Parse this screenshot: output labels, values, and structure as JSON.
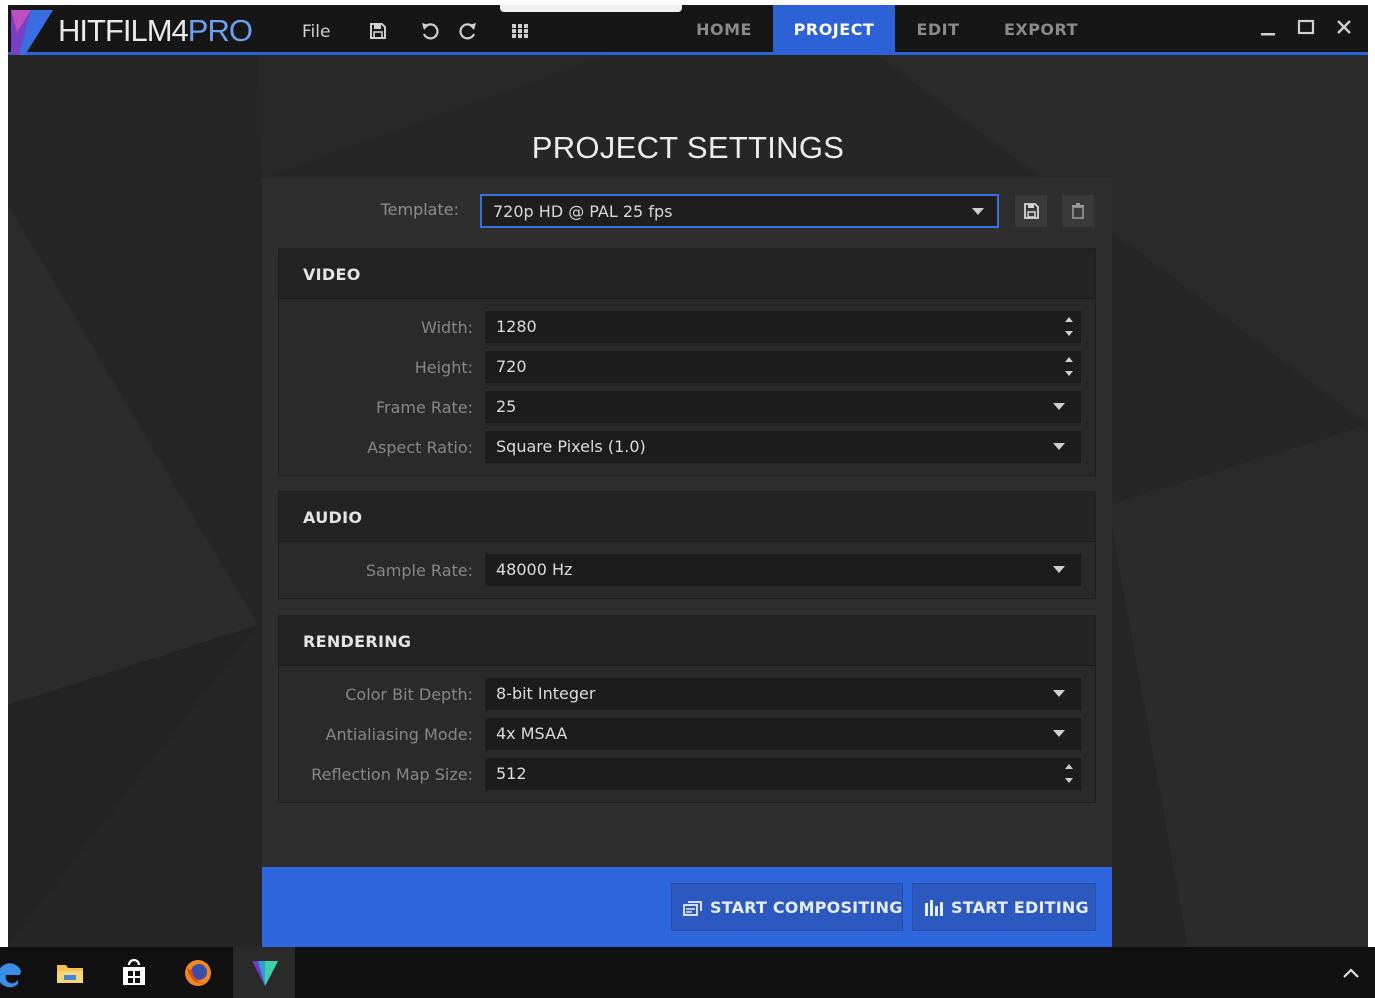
{
  "app": {
    "brand_main": "HITFILM4",
    "brand_pro": "PRO",
    "menu_file": "File",
    "tabs": [
      {
        "label": "HOME",
        "active": false
      },
      {
        "label": "PROJECT",
        "active": true
      },
      {
        "label": "EDIT",
        "active": false
      },
      {
        "label": "EXPORT",
        "active": false
      }
    ],
    "toolbar_icons": [
      "save-icon",
      "undo-icon",
      "redo-icon",
      "grid-icon"
    ],
    "window_controls": [
      "minimize-icon",
      "maximize-icon",
      "close-icon"
    ],
    "accent_color": "#2c62d6"
  },
  "page": {
    "title": "PROJECT SETTINGS"
  },
  "template": {
    "label": "Template:",
    "value": "720p HD @ PAL 25 fps",
    "save_icon": "save-icon",
    "delete_icon": "trash-icon"
  },
  "video": {
    "title": "VIDEO",
    "rows": [
      {
        "label": "Width:",
        "value": "1280",
        "control": "spinner"
      },
      {
        "label": "Height:",
        "value": "720",
        "control": "spinner"
      },
      {
        "label": "Frame Rate:",
        "value": "25",
        "control": "dropdown"
      },
      {
        "label": "Aspect Ratio:",
        "value": "Square Pixels (1.0)",
        "control": "dropdown"
      }
    ]
  },
  "audio": {
    "title": "AUDIO",
    "rows": [
      {
        "label": "Sample Rate:",
        "value": "48000 Hz",
        "control": "dropdown"
      }
    ]
  },
  "rendering": {
    "title": "RENDERING",
    "rows": [
      {
        "label": "Color Bit Depth:",
        "value": "8-bit Integer",
        "control": "dropdown"
      },
      {
        "label": "Antialiasing Mode:",
        "value": "4x MSAA",
        "control": "dropdown"
      },
      {
        "label": "Reflection Map Size:",
        "value": "512",
        "control": "spinner"
      }
    ]
  },
  "actions": {
    "start_compositing": "START COMPOSITING",
    "start_editing": "START EDITING"
  },
  "taskbar": {
    "icons": [
      "edge-icon",
      "file-explorer-icon",
      "store-icon",
      "firefox-icon",
      "hitfilm-icon"
    ],
    "active": "hitfilm-icon",
    "tray_icon": "chevron-up-icon"
  }
}
